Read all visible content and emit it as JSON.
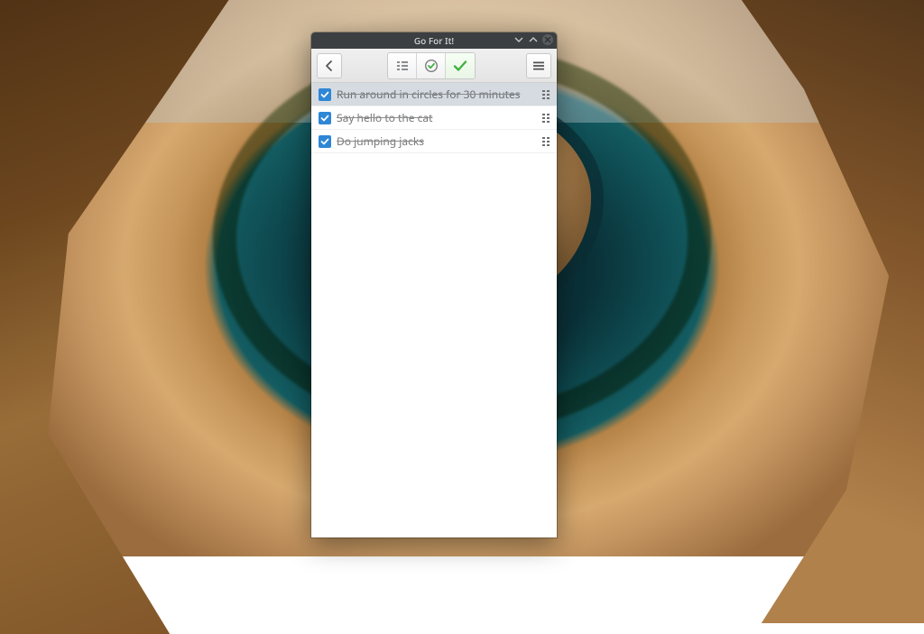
{
  "window": {
    "title": "Go For It!"
  },
  "toolbar": {
    "back_icon": "chevron-left",
    "views": {
      "todo_label": "To-Do",
      "timer_label": "Timer",
      "done_label": "Done",
      "active": "done"
    },
    "menu_icon": "hamburger"
  },
  "tasks": [
    {
      "done": true,
      "label": "Run around in circles for 30 minutes",
      "selected": true
    },
    {
      "done": true,
      "label": "Say hello to the cat",
      "selected": false
    },
    {
      "done": true,
      "label": "Do jumping jacks",
      "selected": false
    }
  ],
  "colors": {
    "accent": "#2e86d7",
    "check_green": "#3fb13f",
    "titlebar": "#3b3f41"
  }
}
